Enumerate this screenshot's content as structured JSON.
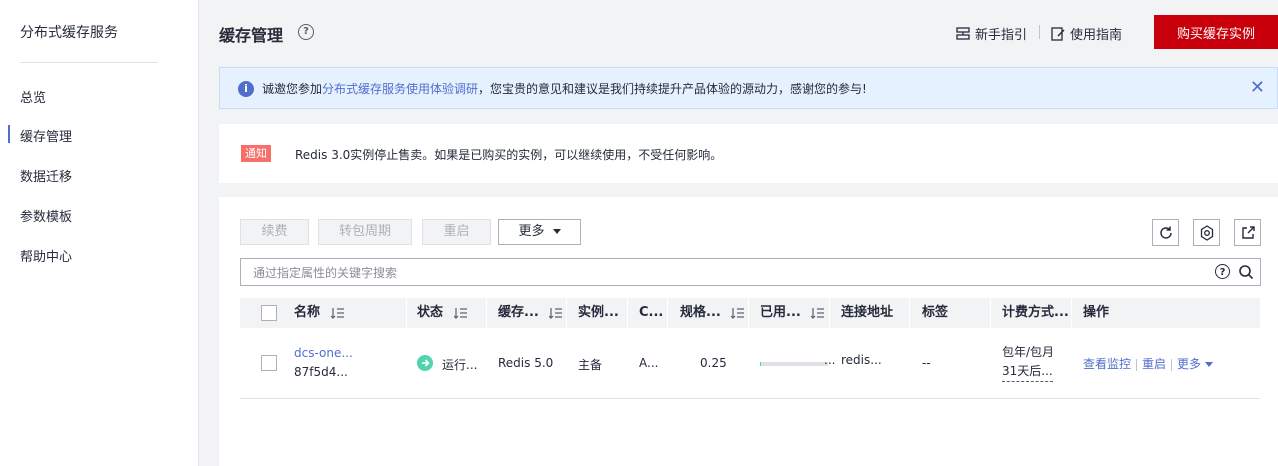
{
  "sidebar": {
    "title": "分布式缓存服务",
    "items": [
      {
        "label": "总览",
        "active": false
      },
      {
        "label": "缓存管理",
        "active": true
      },
      {
        "label": "数据迁移",
        "active": false
      },
      {
        "label": "参数模板",
        "active": false
      },
      {
        "label": "帮助中心",
        "active": false
      }
    ]
  },
  "header": {
    "title": "缓存管理",
    "help_mark": "?",
    "guide_label": "新手指引",
    "manual_label": "使用指南",
    "buy_label": "购买缓存实例"
  },
  "info_banner": {
    "icon": "i",
    "text_before": "诚邀您参加",
    "link_text": "分布式缓存服务使用体验调研",
    "text_after": "，您宝贵的意见和建议是我们持续提升产品体验的源动力，感谢您的参与!",
    "close": "✕"
  },
  "notice": {
    "badge": "通知",
    "text": "Redis 3.0实例停止售卖。如果是已购买的实例，可以继续使用，不受任何影响。"
  },
  "toolbar": {
    "renew": "续费",
    "to_monthly": "转包周期",
    "restart": "重启",
    "more": "更多"
  },
  "search": {
    "placeholder": "通过指定属性的关键字搜索",
    "help_mark": "?"
  },
  "table": {
    "columns": [
      "名称",
      "状态",
      "缓存...",
      "实例...",
      "C...",
      "规格...",
      "已用...",
      "连接地址",
      "标签",
      "计费方式...",
      "操作"
    ],
    "rows": [
      {
        "name_line1": "dcs-one...",
        "name_line2": "87f5d4...",
        "status": "运行...",
        "cache_type": "Redis 5.0",
        "instance_type": "主备",
        "c_col": "A...",
        "spec": "0.25",
        "used_ratio": 0.02,
        "used_text": "...",
        "address": "redis...",
        "tags": "--",
        "billing_line1": "包年/包月",
        "billing_line2": "31天后...",
        "ops": [
          "查看监控",
          "重启",
          "更多"
        ]
      }
    ]
  },
  "colors": {
    "brand_red": "#c7000b",
    "link_blue": "#526ecc",
    "status_green": "#50d4ab",
    "notice_red": "#f66f6a"
  }
}
